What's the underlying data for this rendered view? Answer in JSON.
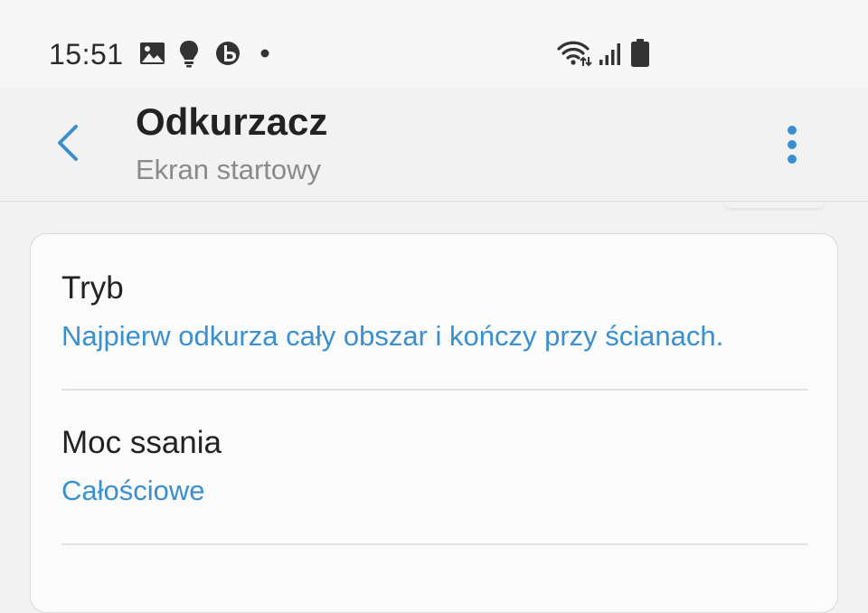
{
  "status_bar": {
    "time": "15:51",
    "left_icons": [
      "gallery-icon",
      "bulb-icon",
      "bixby-icon",
      "dot-icon"
    ],
    "right_icons": [
      "wifi-icon",
      "signal-icon",
      "battery-icon"
    ]
  },
  "app_bar": {
    "title": "Odkurzacz",
    "subtitle": "Ekran startowy",
    "back_icon": "chevron-left-icon",
    "more_icon": "more-vertical-icon"
  },
  "settings": {
    "items": [
      {
        "label": "Tryb",
        "value": "Najpierw odkurza cały obszar i kończy przy ścianach."
      },
      {
        "label": "Moc ssania",
        "value": "Całościowe"
      }
    ]
  },
  "colors": {
    "accent": "#3a8fcf",
    "title": "#222222",
    "subtitle": "#8a8a8a",
    "background": "#f2f2f2",
    "card": "#fbfbfb"
  }
}
